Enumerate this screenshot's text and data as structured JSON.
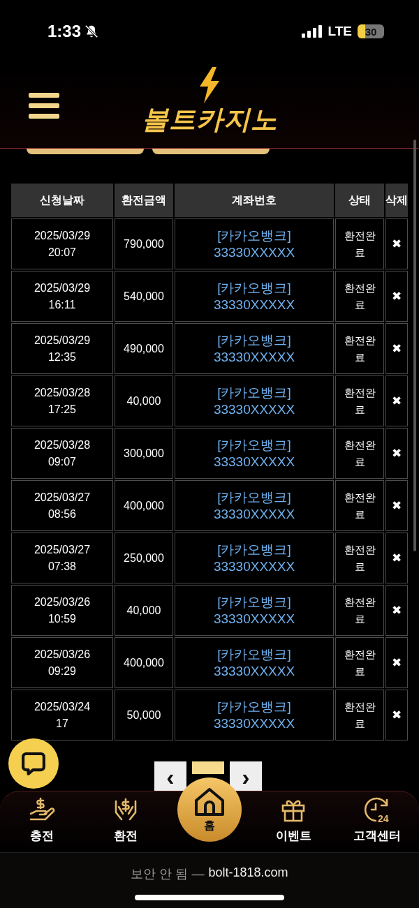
{
  "status_bar": {
    "time": "1:33",
    "network": "LTE",
    "battery": "30"
  },
  "header": {
    "logo": "볼트카지노"
  },
  "table": {
    "columns": [
      "신청날짜",
      "환전금액",
      "계좌번호",
      "상태",
      "삭제"
    ],
    "rows": [
      {
        "date": "2025/03/29",
        "time": "20:07",
        "amount": "790,000",
        "bank": "[카카오뱅크]",
        "account": "33330XXXXX",
        "status": "환전완료",
        "delete": "✖"
      },
      {
        "date": "2025/03/29",
        "time": "16:11",
        "amount": "540,000",
        "bank": "[카카오뱅크]",
        "account": "33330XXXXX",
        "status": "환전완료",
        "delete": "✖"
      },
      {
        "date": "2025/03/29",
        "time": "12:35",
        "amount": "490,000",
        "bank": "[카카오뱅크]",
        "account": "33330XXXXX",
        "status": "환전완료",
        "delete": "✖"
      },
      {
        "date": "2025/03/28",
        "time": "17:25",
        "amount": "40,000",
        "bank": "[카카오뱅크]",
        "account": "33330XXXXX",
        "status": "환전완료",
        "delete": "✖"
      },
      {
        "date": "2025/03/28",
        "time": "09:07",
        "amount": "300,000",
        "bank": "[카카오뱅크]",
        "account": "33330XXXXX",
        "status": "환전완료",
        "delete": "✖"
      },
      {
        "date": "2025/03/27",
        "time": "08:56",
        "amount": "400,000",
        "bank": "[카카오뱅크]",
        "account": "33330XXXXX",
        "status": "환전완료",
        "delete": "✖"
      },
      {
        "date": "2025/03/27",
        "time": "07:38",
        "amount": "250,000",
        "bank": "[카카오뱅크]",
        "account": "33330XXXXX",
        "status": "환전완료",
        "delete": "✖"
      },
      {
        "date": "2025/03/26",
        "time": "10:59",
        "amount": "40,000",
        "bank": "[카카오뱅크]",
        "account": "33330XXXXX",
        "status": "환전완료",
        "delete": "✖"
      },
      {
        "date": "2025/03/26",
        "time": "09:29",
        "amount": "400,000",
        "bank": "[카카오뱅크]",
        "account": "33330XXXXX",
        "status": "환전완료",
        "delete": "✖"
      },
      {
        "date": "2025/03/24",
        "time": "17",
        "amount": "50,000",
        "bank": "[카카오뱅크]",
        "account": "33330XXXXX",
        "status": "환전완료",
        "delete": "✖"
      }
    ]
  },
  "pagination": {
    "prev": "‹",
    "next": "›",
    "pages": [
      {
        "selected": true
      }
    ]
  },
  "bottom_nav": [
    {
      "kind": "charge",
      "label": "충전",
      "selected": false
    },
    {
      "kind": "exchange",
      "label": "환전",
      "selected": false
    },
    {
      "kind": "home",
      "label": "홈",
      "selected": true
    },
    {
      "kind": "event",
      "label": "이벤트",
      "selected": false
    },
    {
      "kind": "support",
      "label": "고객센터",
      "badge": "24",
      "selected": false
    }
  ],
  "browser": {
    "security": "보안 안 됨 —",
    "url": "bolt-1818.com"
  }
}
